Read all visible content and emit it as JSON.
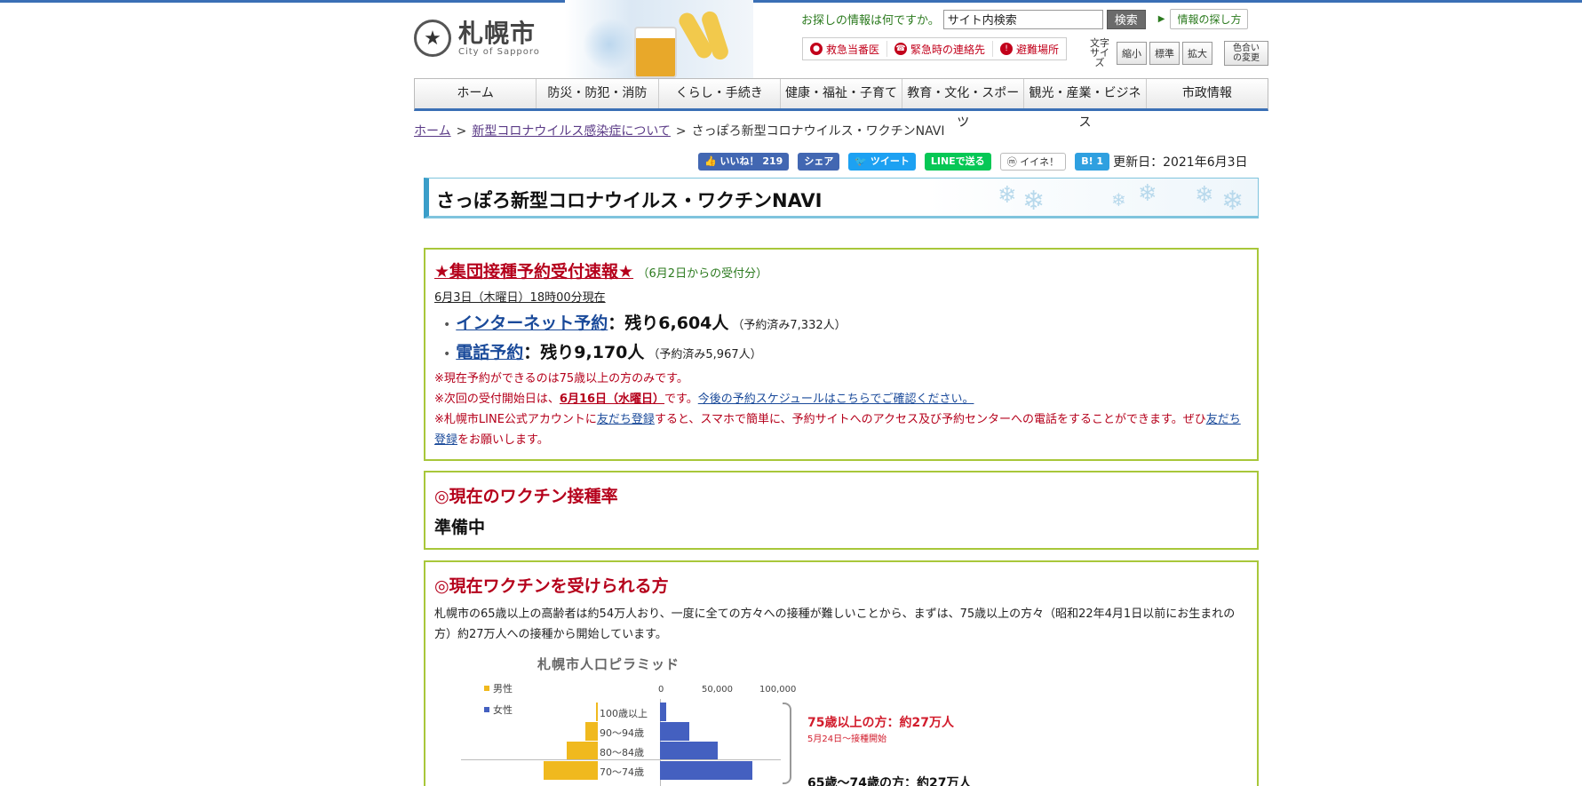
{
  "header": {
    "logo_jp": "札幌市",
    "logo_en": "City of Sapporo",
    "search_label": "お探しの情報は何ですか。",
    "search_placeholder": "サイト内検索",
    "search_button": "検索",
    "howto_button": "情報の探し方",
    "emergency": [
      {
        "label": "救急当番医",
        "icon": "hospital-icon"
      },
      {
        "label": "緊急時の連絡先",
        "icon": "phone-icon"
      },
      {
        "label": "避難場所",
        "icon": "shelter-icon"
      }
    ],
    "fontsize_label_1": "文字",
    "fontsize_label_2": "サイズ",
    "fontsize_small": "縮小",
    "fontsize_normal": "標準",
    "fontsize_large": "拡大",
    "color_line1": "色合い",
    "color_line2": "の変更"
  },
  "nav": [
    "ホーム",
    "防災・防犯・消防",
    "くらし・手続き",
    "健康・福祉・子育て",
    "教育・文化・スポーツ",
    "観光・産業・ビジネス",
    "市政情報"
  ],
  "breadcrumb": {
    "home": "ホーム",
    "sep": ">",
    "parent": "新型コロナウイルス感染症について",
    "current": "さっぽろ新型コロナウイルス・ワクチンNAVI"
  },
  "social": {
    "like": "いいね！ 219",
    "share": "シェア",
    "tweet": "ツイート",
    "line": "LINEで送る",
    "mixi": "イイネ！",
    "hatena": "B! 1",
    "updated": "更新日：2021年6月3日"
  },
  "page_title": "さっぽろ新型コロナウイルス・ワクチンNAVI",
  "box1": {
    "heading": "★集団接種予約受付速報★",
    "heading_note": "（6月2日からの受付分）",
    "as_of": "6月3日（木曜日）18時00分現在",
    "internet_link": "インターネット予約",
    "internet_remain": "：残り6,604人",
    "internet_booked": "（予約済み7,332人）",
    "phone_link": "電話予約",
    "phone_remain": "：残り9,170人",
    "phone_booked": "（予約済み5,967人）",
    "note1": "※現在予約ができるのは75歳以上の方のみです。",
    "note2_pre": "※次回の受付開始日は、",
    "note2_date": "6月16日（水曜日）",
    "note2_mid": "です。",
    "note2_link": "今後の予約スケジュールはこちらでご確認ください。",
    "note3_pre": "※札幌市LINE公式アカウントに",
    "note3_link1": "友だち登録",
    "note3_mid": "すると、スマホで簡単に、予約サイトへのアクセス及び予約センターへの電話をすることができます。ぜひ",
    "note3_link2": "友だち登録",
    "note3_post": "をお願いします。"
  },
  "box2": {
    "heading": "◎現在のワクチン接種率",
    "status": "準備中"
  },
  "box3": {
    "heading": "◎現在ワクチンを受けられる方",
    "paragraph": "札幌市の65歳以上の高齢者は約54万人おり、一度に全ての方々への接種が難しいことから、まずは、75歳以上の方々（昭和22年4月1日以前にお生まれの方）約27万人への接種から開始しています。"
  },
  "chart_data": {
    "type": "bar",
    "title": "札幌市人口ピラミッド",
    "legend": [
      "男性",
      "女性"
    ],
    "x_ticks": [
      "0",
      "50,000",
      "100,000"
    ],
    "xlim": [
      0,
      100000
    ],
    "categories": [
      "100歳以上",
      "90～94歳",
      "80～84歳",
      "70～74歳"
    ],
    "series": [
      {
        "name": "男性",
        "color": "#f0b91e",
        "values": [
          2000,
          12000,
          30000,
          52000
        ]
      },
      {
        "name": "女性",
        "color": "#4460c0",
        "values": [
          5000,
          25000,
          50000,
          80000
        ]
      }
    ],
    "annotations": [
      {
        "text": "75歳以上の方：約27万人",
        "sub": "5月24日～接種開始",
        "color": "#d21c2c"
      },
      {
        "text": "65歳～74歳の方：約27万人",
        "color": "#111111"
      }
    ]
  }
}
